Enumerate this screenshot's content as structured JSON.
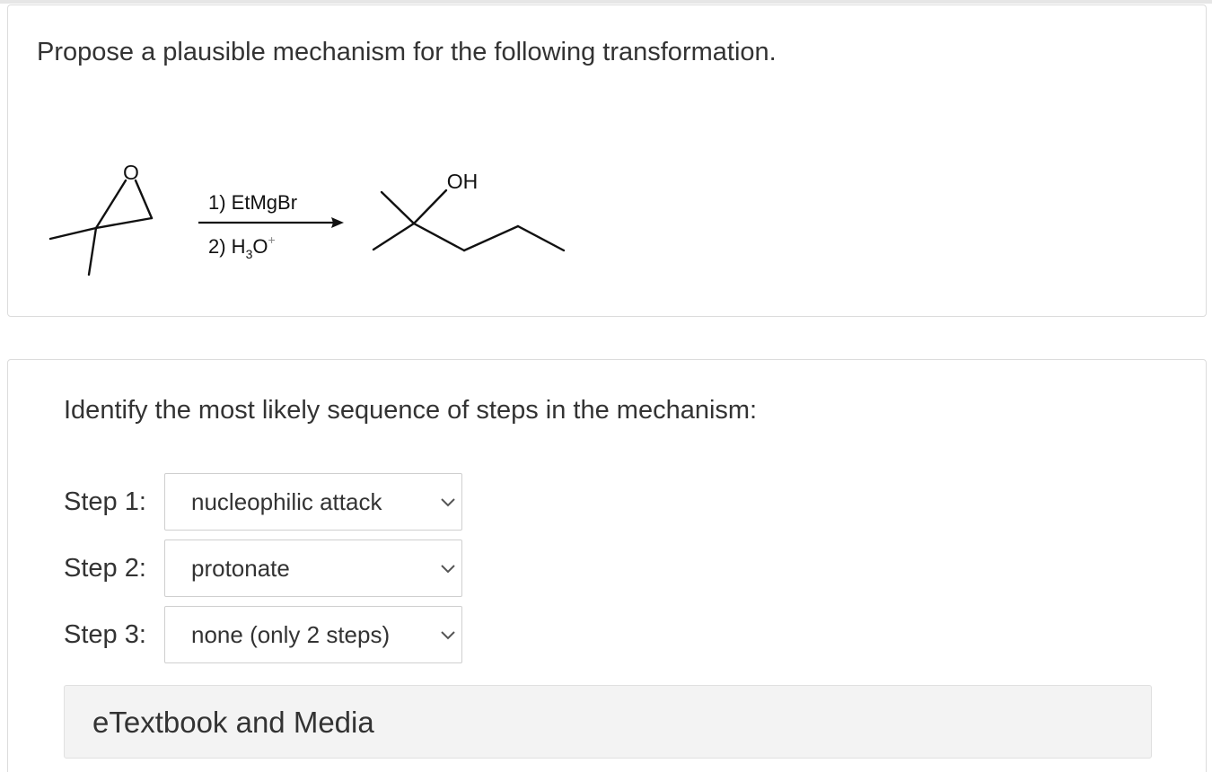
{
  "question": {
    "prompt": "Propose a plausible mechanism for the following transformation.",
    "reaction": {
      "reactant_atom_label": "O",
      "reagent_1": "1) EtMgBr",
      "reagent_2_prefix": "2) H",
      "reagent_2_subscript": "3",
      "reagent_2_atom": "O",
      "reagent_2_superscript": "+",
      "product_atom_label": "OH"
    }
  },
  "answer": {
    "instruction": "Identify the most likely sequence of steps in the mechanism:",
    "steps": [
      {
        "label": "Step 1:",
        "selected": "nucleophilic attack"
      },
      {
        "label": "Step 2:",
        "selected": "protonate"
      },
      {
        "label": "Step 3:",
        "selected": "none (only 2 steps)"
      }
    ],
    "etextbook_label": "eTextbook and Media"
  },
  "icons": {
    "dropdown": "chevron-down-icon"
  },
  "colors": {
    "text": "#333333",
    "border": "#dcdcdc",
    "panel": "#f3f3f3"
  }
}
